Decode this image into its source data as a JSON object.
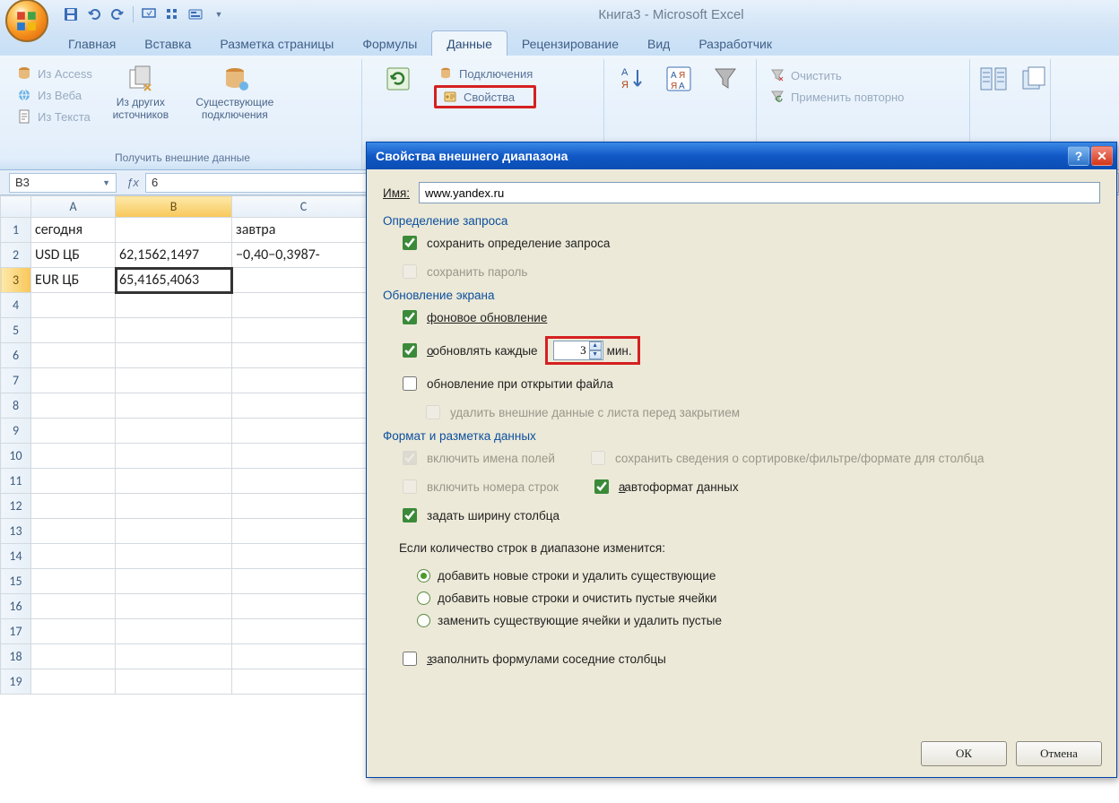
{
  "window": {
    "title": "Книга3 - Microsoft Excel"
  },
  "tabs": {
    "home": "Главная",
    "insert": "Вставка",
    "pagelayout": "Разметка страницы",
    "formulas": "Формулы",
    "data": "Данные",
    "review": "Рецензирование",
    "view": "Вид",
    "developer": "Разработчик"
  },
  "ribbon": {
    "get_external": {
      "access": "Из Access",
      "web": "Из Веба",
      "text": "Из Текста",
      "other": "Из других\nисточников",
      "existing": "Существующие\nподключения",
      "group": "Получить внешние данные"
    },
    "connections": {
      "refresh": "Обновить",
      "connections": "Подключения",
      "properties": "Свойства"
    },
    "sortfilter": {
      "clear": "Очистить",
      "reapply": "Применить повторно"
    }
  },
  "namebox": "B3",
  "formula_preview": "6",
  "sheet": {
    "cols": [
      "A",
      "B",
      "C"
    ],
    "rows": [
      {
        "r": "1",
        "cells": [
          "сегодня",
          "",
          "завтра"
        ]
      },
      {
        "r": "2",
        "cells": [
          "USD ЦБ",
          "62,1562,1497",
          "−0,40−0,3987-"
        ]
      },
      {
        "r": "3",
        "cells": [
          "EUR ЦБ",
          "65,4165,4063",
          ""
        ]
      }
    ],
    "blank_rows": [
      "4",
      "5",
      "6",
      "7",
      "8",
      "9",
      "10",
      "11",
      "12",
      "13",
      "14",
      "15",
      "16",
      "17",
      "18",
      "19"
    ]
  },
  "dialog": {
    "title": "Свойства внешнего диапазона",
    "name_label": "Имя:",
    "name_value": "www.yandex.ru",
    "sec_query": "Определение запроса",
    "save_query": "сохранить определение запроса",
    "save_pwd": "сохранить пароль",
    "sec_refresh": "Обновление экрана",
    "bg_refresh": "фоновое обновление",
    "refresh_every": "обновлять каждые",
    "refresh_val": "3",
    "refresh_unit": "мин.",
    "refresh_open": "обновление при открытии файла",
    "remove_ext": "удалить внешние данные с листа перед закрытием",
    "sec_format": "Формат и разметка данных",
    "include_names": "включить имена полей",
    "preserve_sort": "сохранить сведения о сортировке/фильтре/формате для столбца",
    "include_rownum": "включить номера строк",
    "autoformat": "автоформат данных",
    "adjust_colw": "задать ширину столбца",
    "rows_change": "Если количество строк в диапазоне изменится:",
    "opt_add_del": "добавить новые строки и удалить существующие",
    "opt_add_clear": "добавить новые строки и очистить пустые ячейки",
    "opt_replace": "заменить существующие ячейки и удалить пустые",
    "fill_formulas": "заполнить формулами соседние столбцы",
    "ok": "ОК",
    "cancel": "Отмена"
  }
}
